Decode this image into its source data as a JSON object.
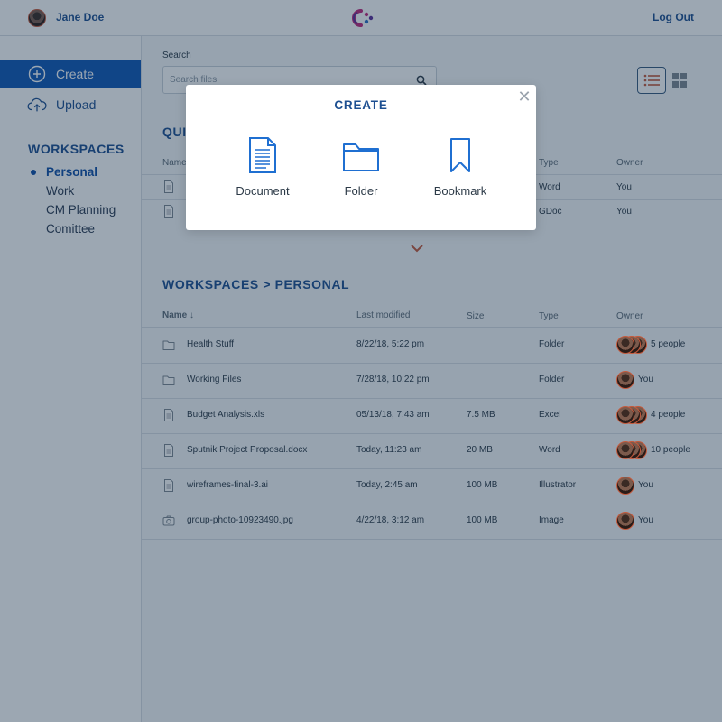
{
  "header": {
    "user_name": "Jane Doe",
    "logout_label": "Log Out"
  },
  "sidebar": {
    "create_label": "Create",
    "upload_label": "Upload",
    "workspaces_title": "WORKSPACES",
    "workspaces": [
      "Personal",
      "Work",
      "CM Planning",
      "Comittee"
    ],
    "active_workspace": "Personal"
  },
  "search": {
    "label": "Search",
    "placeholder": "Search files"
  },
  "quick_access": {
    "title": "QUI",
    "columns": {
      "name": "Name",
      "type": "Type",
      "owner": "Owner"
    },
    "rows": [
      {
        "type": "Word",
        "owner": "You"
      },
      {
        "type": "GDoc",
        "owner": "You"
      }
    ]
  },
  "workspace_section": {
    "title": "WORKSPACES > PERSONAL",
    "columns": {
      "name": "Name ↓",
      "modified": "Last modified",
      "size": "Size",
      "type": "Type",
      "owner": "Owner"
    },
    "rows": [
      {
        "icon": "folder-icon",
        "name": "Health Stuff",
        "modified": "8/22/18, 5:22 pm",
        "size": "",
        "type": "Folder",
        "owner": "5 people",
        "avatars": 3
      },
      {
        "icon": "folder-icon",
        "name": "Working Files",
        "modified": "7/28/18, 10:22 pm",
        "size": "",
        "type": "Folder",
        "owner": "You",
        "avatars": 1
      },
      {
        "icon": "document-icon",
        "name": "Budget Analysis.xls",
        "modified": "05/13/18, 7:43 am",
        "size": "7.5 MB",
        "type": "Excel",
        "owner": "4 people",
        "avatars": 3
      },
      {
        "icon": "document-icon",
        "name": "Sputnik Project Proposal.docx",
        "modified": "Today, 11:23 am",
        "size": "20 MB",
        "type": "Word",
        "owner": "10 people",
        "avatars": 3
      },
      {
        "icon": "document-icon",
        "name": "wireframes-final-3.ai",
        "modified": "Today, 2:45 am",
        "size": "100 MB",
        "type": "Illustrator",
        "owner": "You",
        "avatars": 1
      },
      {
        "icon": "camera-icon",
        "name": "group-photo-10923490.jpg",
        "modified": "4/22/18, 3:12 am",
        "size": "100 MB",
        "type": "Image",
        "owner": "You",
        "avatars": 1
      }
    ]
  },
  "modal": {
    "title": "CREATE",
    "close_icon": "close-icon",
    "options": [
      {
        "label": "Document",
        "icon": "document-icon"
      },
      {
        "label": "Folder",
        "icon": "folder-icon"
      },
      {
        "label": "Bookmark",
        "icon": "bookmark-icon"
      }
    ]
  },
  "colors": {
    "brand_blue": "#1d4f91",
    "active_blue": "#0f57b6",
    "accent_orange": "#c4593c",
    "logo_magenta": "#c0267a",
    "logo_purple": "#5a2e9a"
  }
}
